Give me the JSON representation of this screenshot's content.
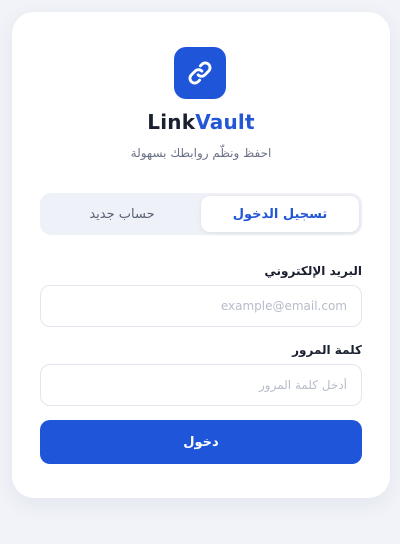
{
  "brand": {
    "name_part1": "Link",
    "name_part2": "Vault",
    "tagline": "احفظ ونظّم روابطك بسهولة",
    "logo_icon": "link-icon"
  },
  "tabs": [
    {
      "label": "تسجيل الدخول",
      "active": true
    },
    {
      "label": "حساب جديد",
      "active": false
    }
  ],
  "form": {
    "email": {
      "label": "البريد الإلكتروني",
      "placeholder": "example@email.com",
      "value": ""
    },
    "password": {
      "label": "كلمة المرور",
      "placeholder": "أدخل كلمة المرور",
      "value": ""
    },
    "submit_label": "دخول"
  },
  "colors": {
    "accent": "#1f55d8",
    "brand_accent": "#2457d6",
    "background": "#f1f3f8",
    "text_dark": "#1b2030",
    "text_muted": "#6c7388"
  }
}
